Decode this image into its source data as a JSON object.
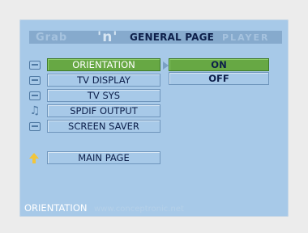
{
  "header": {
    "brand_left": "Grab",
    "brand_mid": "'n'",
    "title": "GENERAL PAGE",
    "brand_right": "PLAYER"
  },
  "menu": {
    "items": [
      {
        "label": "ORIENTATION",
        "icon": "display-orientation-icon",
        "selected": true
      },
      {
        "label": "TV DISPLAY",
        "icon": "tv-display-icon",
        "selected": false
      },
      {
        "label": "TV SYS",
        "icon": "tv-system-icon",
        "selected": false
      },
      {
        "label": "SPDIF OUTPUT",
        "icon": "music-note-icon",
        "selected": false
      },
      {
        "label": "SCREEN SAVER",
        "icon": "screen-saver-icon",
        "selected": false
      }
    ],
    "main_page": {
      "label": "MAIN PAGE",
      "icon": "up-arrow-icon"
    }
  },
  "options": [
    {
      "label": "ON",
      "selected": true
    },
    {
      "label": "OFF",
      "selected": false
    }
  ],
  "status": {
    "current": "ORIENTATION",
    "watermark": "www.conceptronic.net"
  },
  "colors": {
    "screen_bg": "#a7c9e8",
    "selected_bg": "#67a844",
    "text": "#0d1f4a",
    "main_page_arrow": "#f2c53a"
  }
}
